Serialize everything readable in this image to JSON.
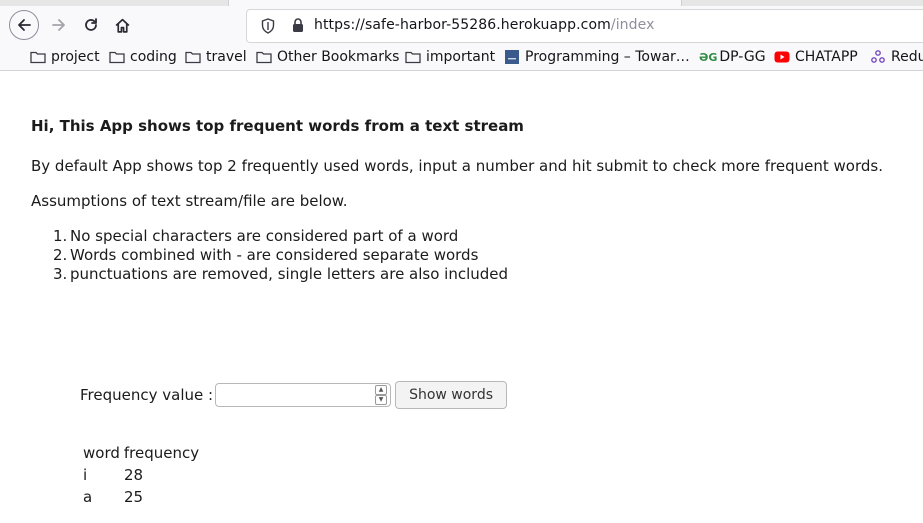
{
  "browser": {
    "url_host": "https://safe-harbor-55286.herokuapp.com",
    "url_path": "/index"
  },
  "bookmarks": [
    {
      "label": "project",
      "icon": "folder-icon"
    },
    {
      "label": "coding",
      "icon": "folder-icon"
    },
    {
      "label": "travel",
      "icon": "folder-icon"
    },
    {
      "label": "Other Bookmarks",
      "icon": "folder-icon"
    },
    {
      "label": "important",
      "icon": "folder-icon"
    },
    {
      "label": "Programming – Towar…",
      "icon": "towards-favicon-icon"
    },
    {
      "label": "DP-GG",
      "icon": "geeksforgeeks-favicon-icon"
    },
    {
      "label": "CHATAPP",
      "icon": "youtube-favicon-icon"
    },
    {
      "label": "Redu",
      "icon": "redux-favicon-icon"
    }
  ],
  "page": {
    "heading": "Hi, This App shows top frequent words from a text stream",
    "intro": "By default App shows top 2 frequently used words, input a number and hit submit to check more frequent words.",
    "assumptions_title": "Assumptions of text stream/file are below.",
    "assumptions": [
      {
        "num": "1.",
        "text": "No special characters are considered part of a word"
      },
      {
        "num": "2.",
        "text": "Words combined with - are considered separate words"
      },
      {
        "num": "3.",
        "text": "punctuations are removed, single letters are also included"
      }
    ],
    "frequency_label": "Frequency value :",
    "frequency_value": "",
    "submit_label": "Show words",
    "table": {
      "headers": [
        "word",
        "frequency"
      ],
      "rows": [
        [
          "i",
          "28"
        ],
        [
          "a",
          "25"
        ]
      ]
    }
  },
  "colors": {
    "youtube": "#ff0000",
    "geeks": "#2f8d46",
    "towards": "#3a5a8c",
    "redux": "#764abc"
  }
}
